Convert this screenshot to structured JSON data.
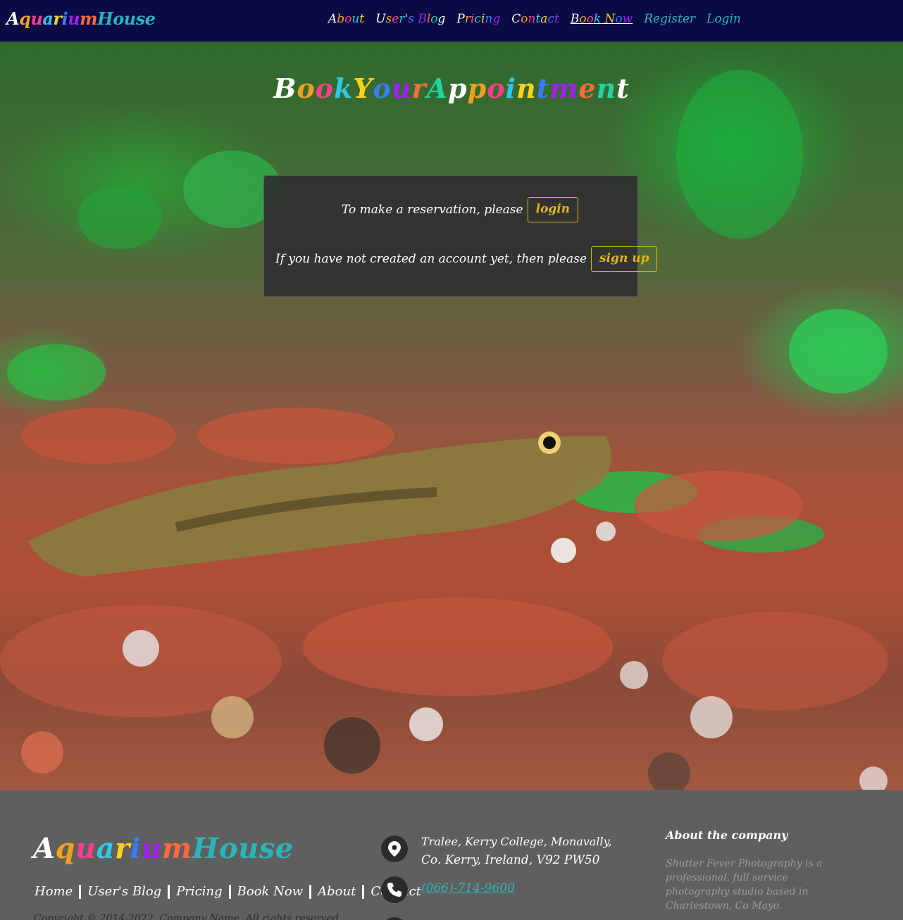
{
  "nav": {
    "brand_part1": "Aquarium",
    "brand_part2": "House",
    "links": [
      {
        "label": "About"
      },
      {
        "label": "User's Blog"
      },
      {
        "label": "Pricing"
      },
      {
        "label": "Contact"
      },
      {
        "label": "Book Now"
      },
      {
        "label": "Register"
      },
      {
        "label": "Login"
      }
    ],
    "active": "Book Now"
  },
  "hero": {
    "title": "Book Your Appointment",
    "background_image": "aquarium-fish-and-shrimp-photo"
  },
  "reservation": {
    "login_prompt": "To make a reservation, please",
    "login_button": "login",
    "signup_prompt": "If you have not created an account yet, then please",
    "signup_button": "sign up"
  },
  "footer": {
    "brand_part1": "Aquarium",
    "brand_part2": "House",
    "links": [
      "Home",
      "User's Blog",
      "Pricing",
      "Book Now",
      "About",
      "Contact"
    ],
    "copyright": "Copyright © 2014-2022, Company Name. All rights reserved.",
    "address_line1": "Tralee, Kerry College, Monavally,",
    "address_line2": "Co. Kerry, Ireland, V92 PW50",
    "phone": "(066)-714-9600",
    "about_heading": "About the company",
    "about_text": "Shutter Fever Photography is a professional, full service photography studio based in Charlestown, Co Mayo."
  },
  "colors": {
    "nav_bg": "#0a0b45",
    "footer_bg": "#5f5f5f",
    "accent_teal": "#29b5b8",
    "button_gold": "#e2b41a",
    "rainbow": [
      "#ffffff",
      "#f0a020",
      "#ff3d8b",
      "#2ec8e8",
      "#ffd21a",
      "#3a7bff",
      "#a020f0",
      "#ff6a3d",
      "#22d4a0"
    ]
  },
  "icons": {
    "address": "location-pin-icon",
    "phone": "phone-icon",
    "email": "envelope-icon"
  }
}
